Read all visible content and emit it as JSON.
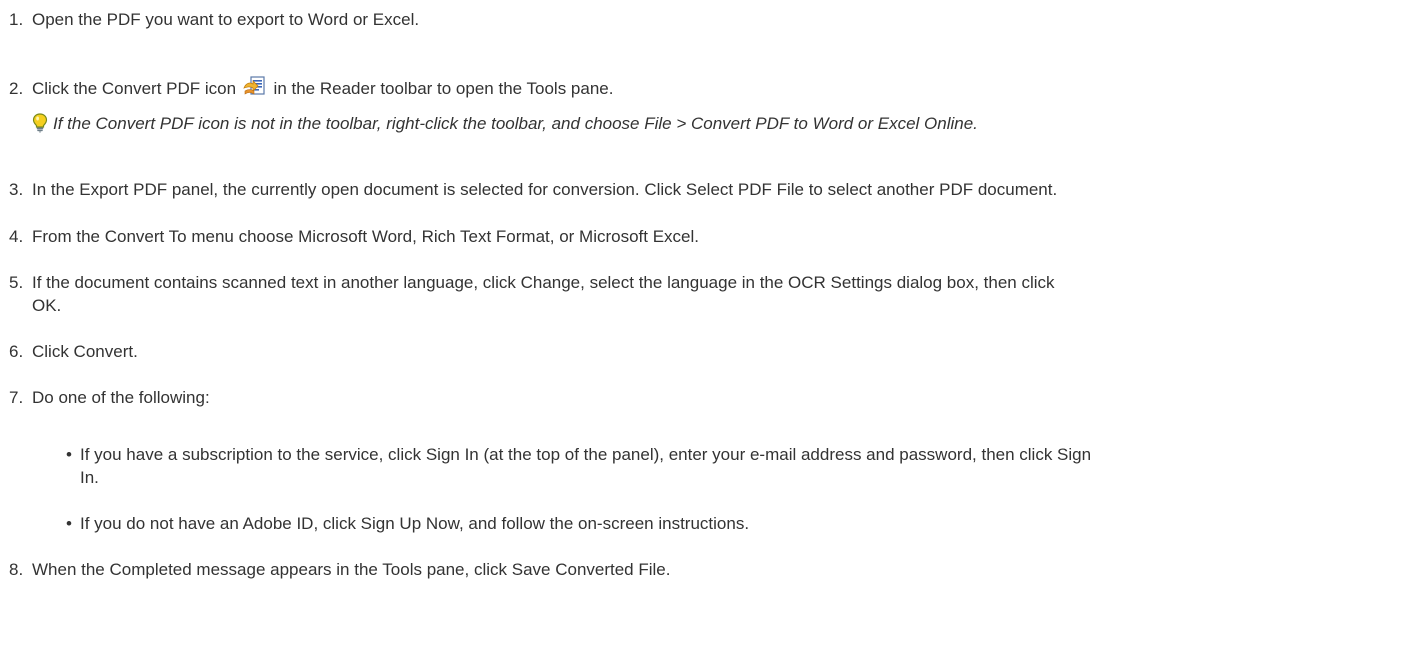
{
  "steps": [
    {
      "num": "1.",
      "text": "Open the PDF you want to export to Word or Excel."
    },
    {
      "num": "2.",
      "text_before_icon": "Click the Convert PDF icon",
      "text_after_icon": " in the Reader toolbar to open the Tools pane."
    },
    {
      "num": "3.",
      "text": "In the Export PDF panel, the currently open document is selected for conversion. Click Select PDF File to select another PDF document."
    },
    {
      "num": "4.",
      "text": "From the Convert To menu choose Microsoft Word, Rich Text Format, or Microsoft Excel."
    },
    {
      "num": "5.",
      "text_line1": "If the document contains scanned text in another language, click Change, select the language in the OCR Settings dialog box, then click",
      "text_line2": "OK."
    },
    {
      "num": "6.",
      "text": "Click Convert."
    },
    {
      "num": "7.",
      "text": "Do one of the following:"
    },
    {
      "num": "8.",
      "text": "When the Completed message appears in the Tools pane, click Save Converted File."
    }
  ],
  "tip": {
    "icon": "lightbulb-icon",
    "text": "If the Convert PDF icon is not in the toolbar, right-click the toolbar, and choose File > Convert PDF to Word or Excel Online."
  },
  "bullets": [
    {
      "line1": "If you have a subscription to the service, click Sign In (at the top of the panel), enter your e-mail address and password, then click Sign",
      "line2": "In."
    },
    {
      "line1": "If you do not have an Adobe ID, click Sign Up Now, and follow the on-screen instructions."
    }
  ],
  "bullet_char": "•",
  "colors": {
    "text": "#333333",
    "background": "#ffffff",
    "bulb": "#f2c200"
  }
}
